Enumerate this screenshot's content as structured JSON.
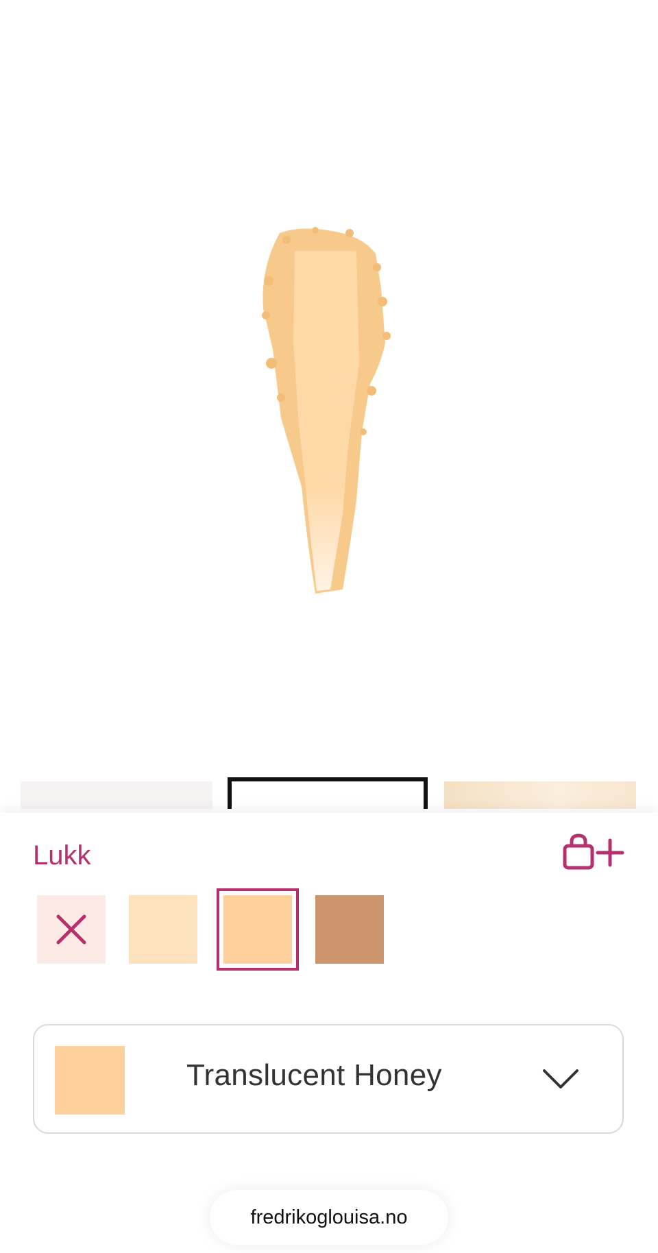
{
  "header": {
    "close_label": "Lukk"
  },
  "icons": {
    "cart_add": "shopping-bag-plus-icon",
    "clear": "close-icon",
    "chevron": "chevron-down-icon"
  },
  "colors": {
    "accent": "#b5306c",
    "shade_none_bg": "#fdeae5",
    "shade_1": "#fde3bd",
    "shade_2": "#fdcf9a",
    "shade_3": "#cc956b"
  },
  "shades": [
    {
      "type": "none",
      "icon": "close-icon"
    },
    {
      "type": "color",
      "color": "#fde3bd"
    },
    {
      "type": "color",
      "color": "#fdcf9a",
      "selected": true
    },
    {
      "type": "color",
      "color": "#cc956b"
    }
  ],
  "selector": {
    "selected_label": "Translucent Honey",
    "selected_color": "#fdcf9a"
  },
  "browser": {
    "url": "fredrikoglouisa.no"
  }
}
